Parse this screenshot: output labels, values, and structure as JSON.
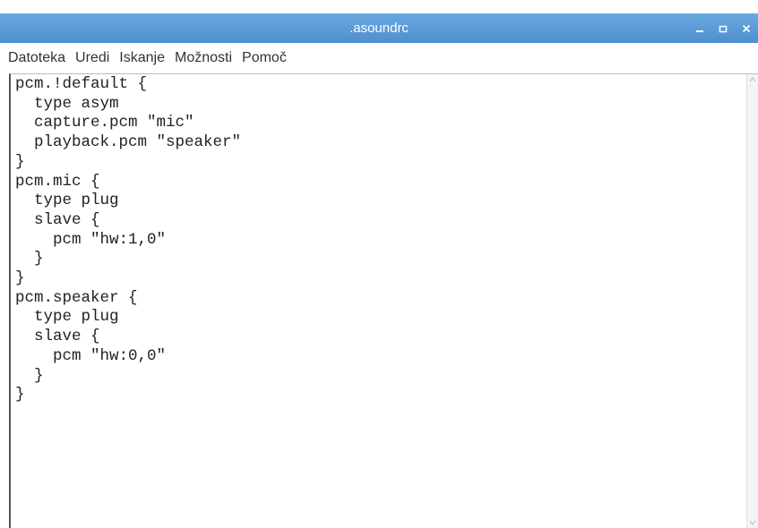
{
  "window": {
    "title": ".asoundrc"
  },
  "controls": {
    "minimize_icon": "minimize-icon",
    "maximize_icon": "maximize-icon",
    "close_icon": "close-icon"
  },
  "menu": {
    "items": [
      {
        "label": "Datoteka"
      },
      {
        "label": "Uredi"
      },
      {
        "label": "Iskanje"
      },
      {
        "label": "Možnosti"
      },
      {
        "label": "Pomoč"
      }
    ]
  },
  "editor": {
    "content": "pcm.!default {\n  type asym\n  capture.pcm \"mic\"\n  playback.pcm \"speaker\"\n}\npcm.mic {\n  type plug\n  slave {\n    pcm \"hw:1,0\"\n  }\n}\npcm.speaker {\n  type plug\n  slave {\n    pcm \"hw:0,0\"\n  }\n}"
  },
  "colors": {
    "titlebar": "#5b9bd5",
    "title_text": "#ffffff",
    "menu_text": "#333333",
    "editor_text": "#222222"
  }
}
